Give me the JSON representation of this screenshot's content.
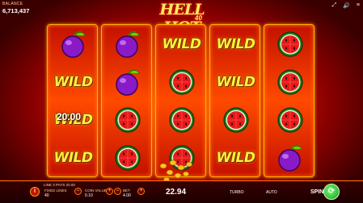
{
  "header": {
    "balance_label": "BALANCE",
    "balance_value": "6,713,437",
    "icons": [
      "fullscreen-icon",
      "sound-icon",
      "menu-icon"
    ],
    "icon_glyphs": [
      "⤢",
      "🔊",
      "≡"
    ]
  },
  "logo": {
    "title": "HELL HOT",
    "number": "40"
  },
  "reels": [
    [
      "plum",
      "wild",
      "wild",
      "wild"
    ],
    [
      "plum",
      "plum",
      "watermelon",
      "watermelon"
    ],
    [
      "wild",
      "watermelon",
      "watermelon",
      "watermelon"
    ],
    [
      "wild",
      "wild",
      "watermelon",
      "wild"
    ],
    [
      "watermelon",
      "watermelon",
      "watermelon",
      "plum"
    ]
  ],
  "wild_label": "WILD",
  "win_overlay": "20.00",
  "footer": {
    "line_info": "LINE 3 PAYS 20.00",
    "info_icon": "i",
    "fixed_lines_label": "FIXED LINES",
    "fixed_lines_value": "40",
    "coin_value_label": "COIN VALUE",
    "coin_value_value": "0.10",
    "bet_label": "BET",
    "bet_value": "4.00",
    "total_win": "22.94",
    "turbo_label": "TURBO",
    "auto_label": "AUTO",
    "spin_label": "SPIN",
    "minus": "−",
    "plus": "+"
  },
  "colors": {
    "reel_border": "#ffb000",
    "wild_text": "#fff23a",
    "spin_button": "#2bd22b",
    "background": "#e01a00"
  }
}
